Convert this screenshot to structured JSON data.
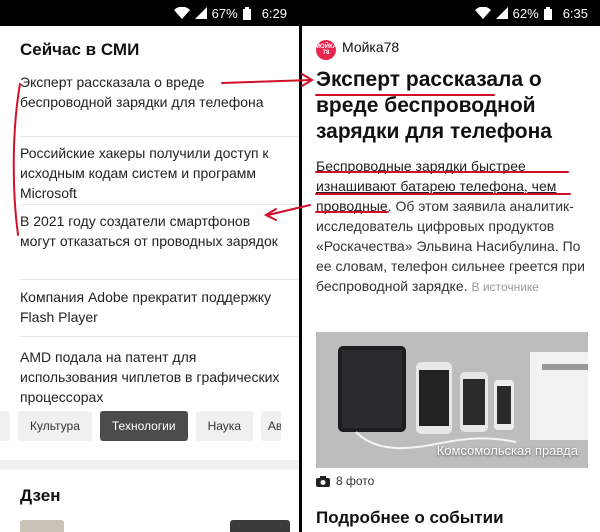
{
  "left": {
    "status": {
      "battery": "67%",
      "time": "6:29"
    },
    "section_title": "Сейчас в СМИ",
    "news": [
      "Эксперт рассказала о вреде беспроводной зарядки для телефона",
      "Российские хакеры получили доступ к исходным кодам систем и программ Microsoft",
      "В 2021 году создатели смартфонов могут отказаться от проводных зарядок",
      "Компания Adobe прекратит поддержку Flash Player",
      "AMD подала на патент для использования чиплетов в графических процессорах"
    ],
    "tabs": [
      {
        "label": "Культура",
        "active": false
      },
      {
        "label": "Технологии",
        "active": true
      },
      {
        "label": "Наука",
        "active": false
      },
      {
        "label": "Ав",
        "active": false
      }
    ],
    "dzen_title": "Дзен"
  },
  "right": {
    "status": {
      "battery": "62%",
      "time": "6:35"
    },
    "logo_text": "МОЙКА 78",
    "source_name": "Мойка78",
    "headline": "Эксперт рассказала о вреде беспроводной зарядки для телефона",
    "body_highlight": "Беспроводные зарядки быстрее изнашивают батарею телефона, чем проводные",
    "body_rest": ". Об этом заявила аналитик-исследователь цифровых продуктов «Роскачества» Эльвина Насибулина. По ее словам, телефон сильнее греется при беспроводной зарядке.",
    "source_link": "В источнике",
    "photo_caption": "Комсомольская правда",
    "photo_count": "8 фото",
    "more_title": "Подробнее о событии"
  },
  "colors": {
    "annotation": "#d0102a",
    "brand": "#e8264d"
  }
}
